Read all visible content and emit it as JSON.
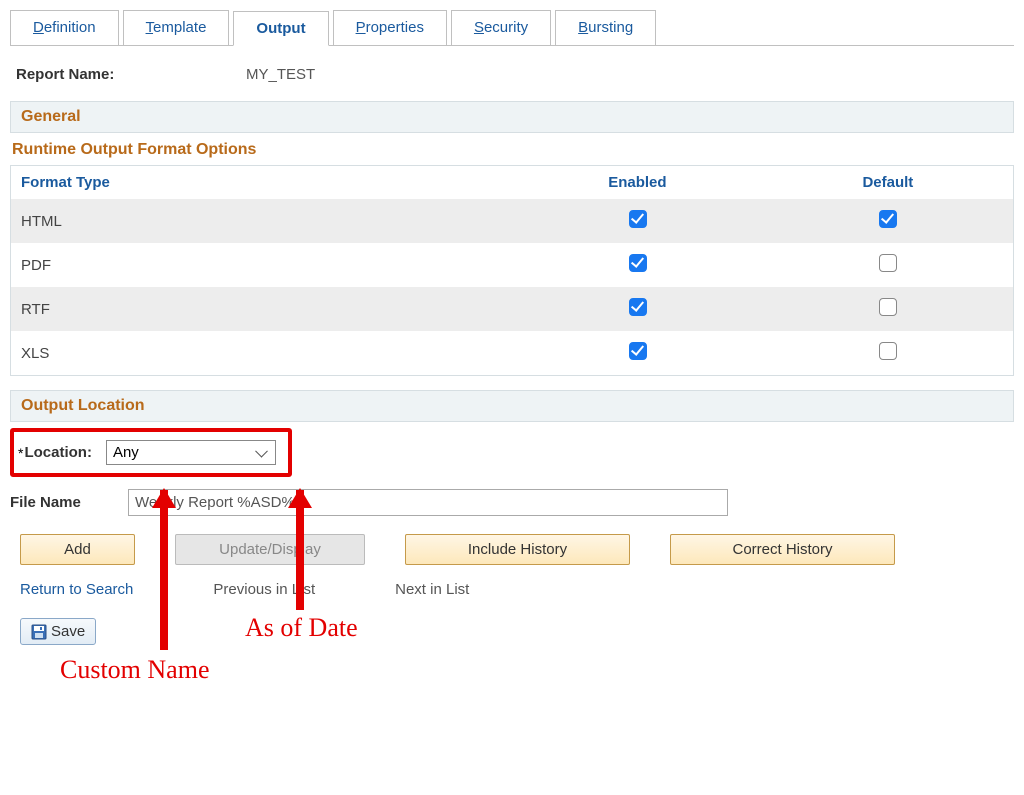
{
  "tabs": {
    "definition": "Definition",
    "template": "Template",
    "output": "Output",
    "properties": "Properties",
    "security": "Security",
    "bursting": "Bursting"
  },
  "report": {
    "name_label": "Report Name:",
    "name_value": "MY_TEST"
  },
  "sections": {
    "general": "General",
    "runtime_title": "Runtime Output Format Options",
    "output_location": "Output Location"
  },
  "format_table": {
    "col_format": "Format Type",
    "col_enabled": "Enabled",
    "col_default": "Default",
    "rows": [
      {
        "type": "HTML",
        "enabled": true,
        "default": true
      },
      {
        "type": "PDF",
        "enabled": true,
        "default": false
      },
      {
        "type": "RTF",
        "enabled": true,
        "default": false
      },
      {
        "type": "XLS",
        "enabled": true,
        "default": false
      }
    ]
  },
  "location": {
    "label": "Location:",
    "value": "Any"
  },
  "filename": {
    "label": "File Name",
    "value": "Weekly Report %ASD%"
  },
  "buttons": {
    "add": "Add",
    "update_display": "Update/Display",
    "include_history": "Include History",
    "correct_history": "Correct History",
    "save": "Save"
  },
  "nav": {
    "return": "Return to Search",
    "prev": "Previous in List",
    "next": "Next in List"
  },
  "annotations": {
    "custom_name": "Custom Name",
    "as_of_date": "As of Date"
  }
}
